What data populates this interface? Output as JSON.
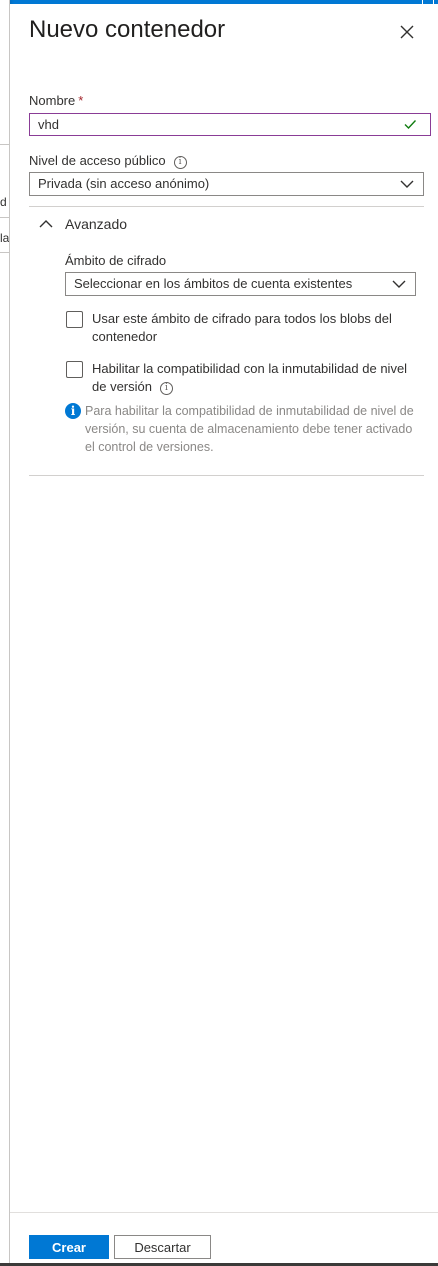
{
  "panel": {
    "title": "Nuevo contenedor",
    "close_icon": "close-icon"
  },
  "name_field": {
    "label": "Nombre",
    "required_mark": "*",
    "value": "vhd",
    "valid": true,
    "status_icon": "checkmark-icon"
  },
  "access_level": {
    "label": "Nivel de acceso público",
    "info_icon": "info-icon",
    "selected": "Privada (sin acceso anónimo)"
  },
  "advanced": {
    "label": "Avanzado",
    "expanded": true,
    "encryption_scope": {
      "label": "Ámbito de cifrado",
      "placeholder": "Seleccionar en los ámbitos de cuenta existentes"
    },
    "checkbox_all_blobs": {
      "label": "Usar este ámbito de cifrado para todos los blobs del contenedor",
      "checked": false
    },
    "checkbox_immutability": {
      "label": "Habilitar la compatibilidad con la inmutabilidad de nivel de versión",
      "checked": false,
      "info_icon": "info-icon"
    },
    "note": "Para habilitar la compatibilidad de inmutabilidad de nivel de versión, su cuenta de almacenamiento debe tener activado el control de versiones."
  },
  "footer": {
    "create_label": "Crear",
    "discard_label": "Descartar"
  },
  "background": {
    "row1_fragment": "d",
    "row2_fragment": "la"
  },
  "colors": {
    "accent": "#0078d4",
    "focus_border": "#8a3c96",
    "valid_check": "#107c10",
    "required": "#a4262c"
  }
}
